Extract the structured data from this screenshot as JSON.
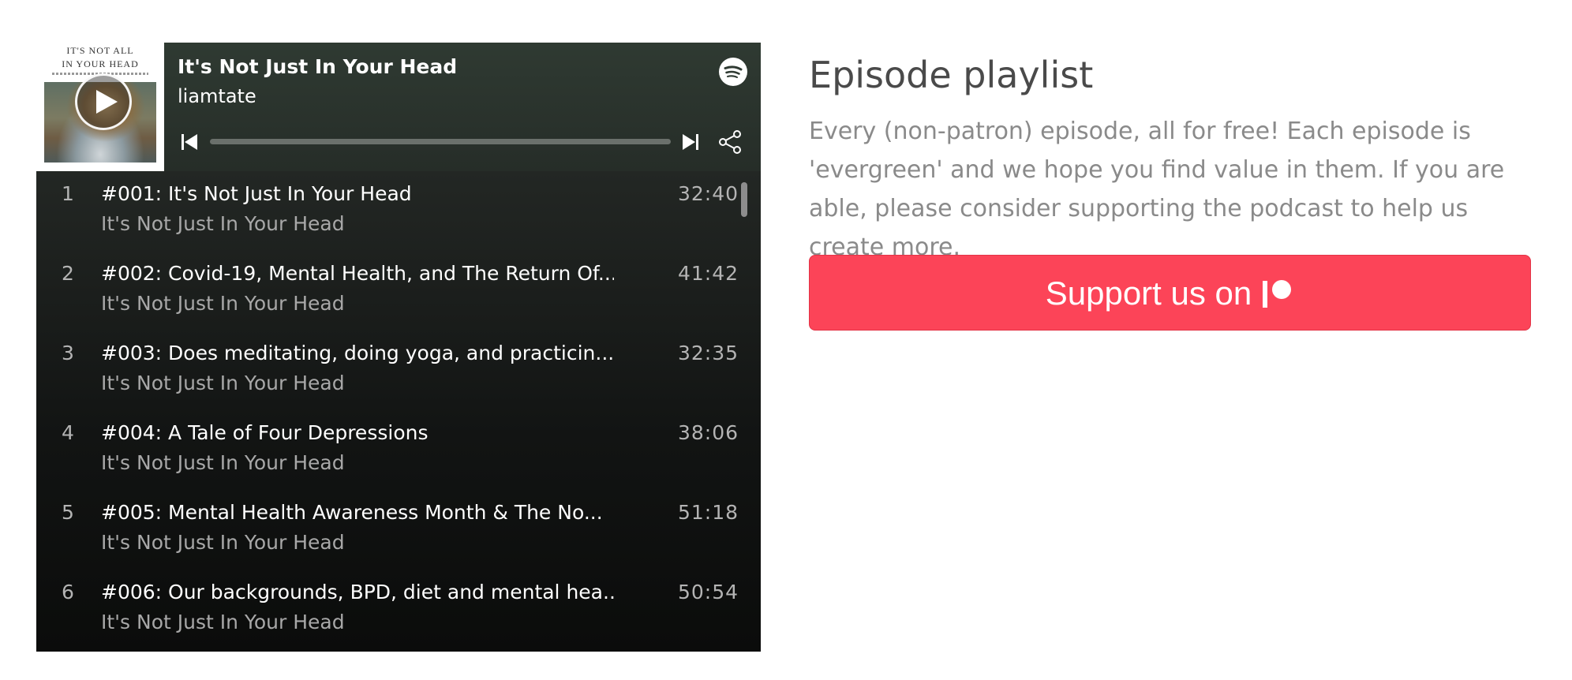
{
  "player": {
    "cover_text_line1": "IT'S NOT ALL",
    "cover_text_line2": "IN YOUR HEAD",
    "now_playing_title": "It's Not Just In Your Head",
    "author": "liamtate"
  },
  "tracks": [
    {
      "num": "1",
      "title": "#001: It's Not Just In Your Head",
      "show": "It's Not Just In Your Head",
      "duration": "32:40"
    },
    {
      "num": "2",
      "title": "#002: Covid-19, Mental Health, and The Return Of...",
      "show": "It's Not Just In Your Head",
      "duration": "41:42"
    },
    {
      "num": "3",
      "title": "#003: Does meditating, doing yoga, and practicin...",
      "show": "It's Not Just In Your Head",
      "duration": "32:35"
    },
    {
      "num": "4",
      "title": "#004: A Tale of Four Depressions",
      "show": "It's Not Just In Your Head",
      "duration": "38:06"
    },
    {
      "num": "5",
      "title": "#005: Mental Health Awareness Month & The No...",
      "show": "It's Not Just In Your Head",
      "duration": "51:18"
    },
    {
      "num": "6",
      "title": "#006: Our backgrounds, BPD, diet and mental hea...",
      "show": "It's Not Just In Your Head",
      "duration": "50:54"
    }
  ],
  "section": {
    "heading": "Episode playlist",
    "description": "Every (non-patron) episode, all for free! Each episode is 'evergreen' and we hope you find value in them. If you are able, please consider supporting the podcast to help us create more.",
    "support_label": "Support us on"
  },
  "colors": {
    "support_button": "#fc4458",
    "player_header": "#2f3a32",
    "player_list": "#121413"
  },
  "icons": {
    "play": "play-icon",
    "spotify": "spotify-logo-icon",
    "prev": "skip-back-icon",
    "next": "skip-forward-icon",
    "share": "share-icon",
    "patreon": "patreon-logo-icon"
  }
}
